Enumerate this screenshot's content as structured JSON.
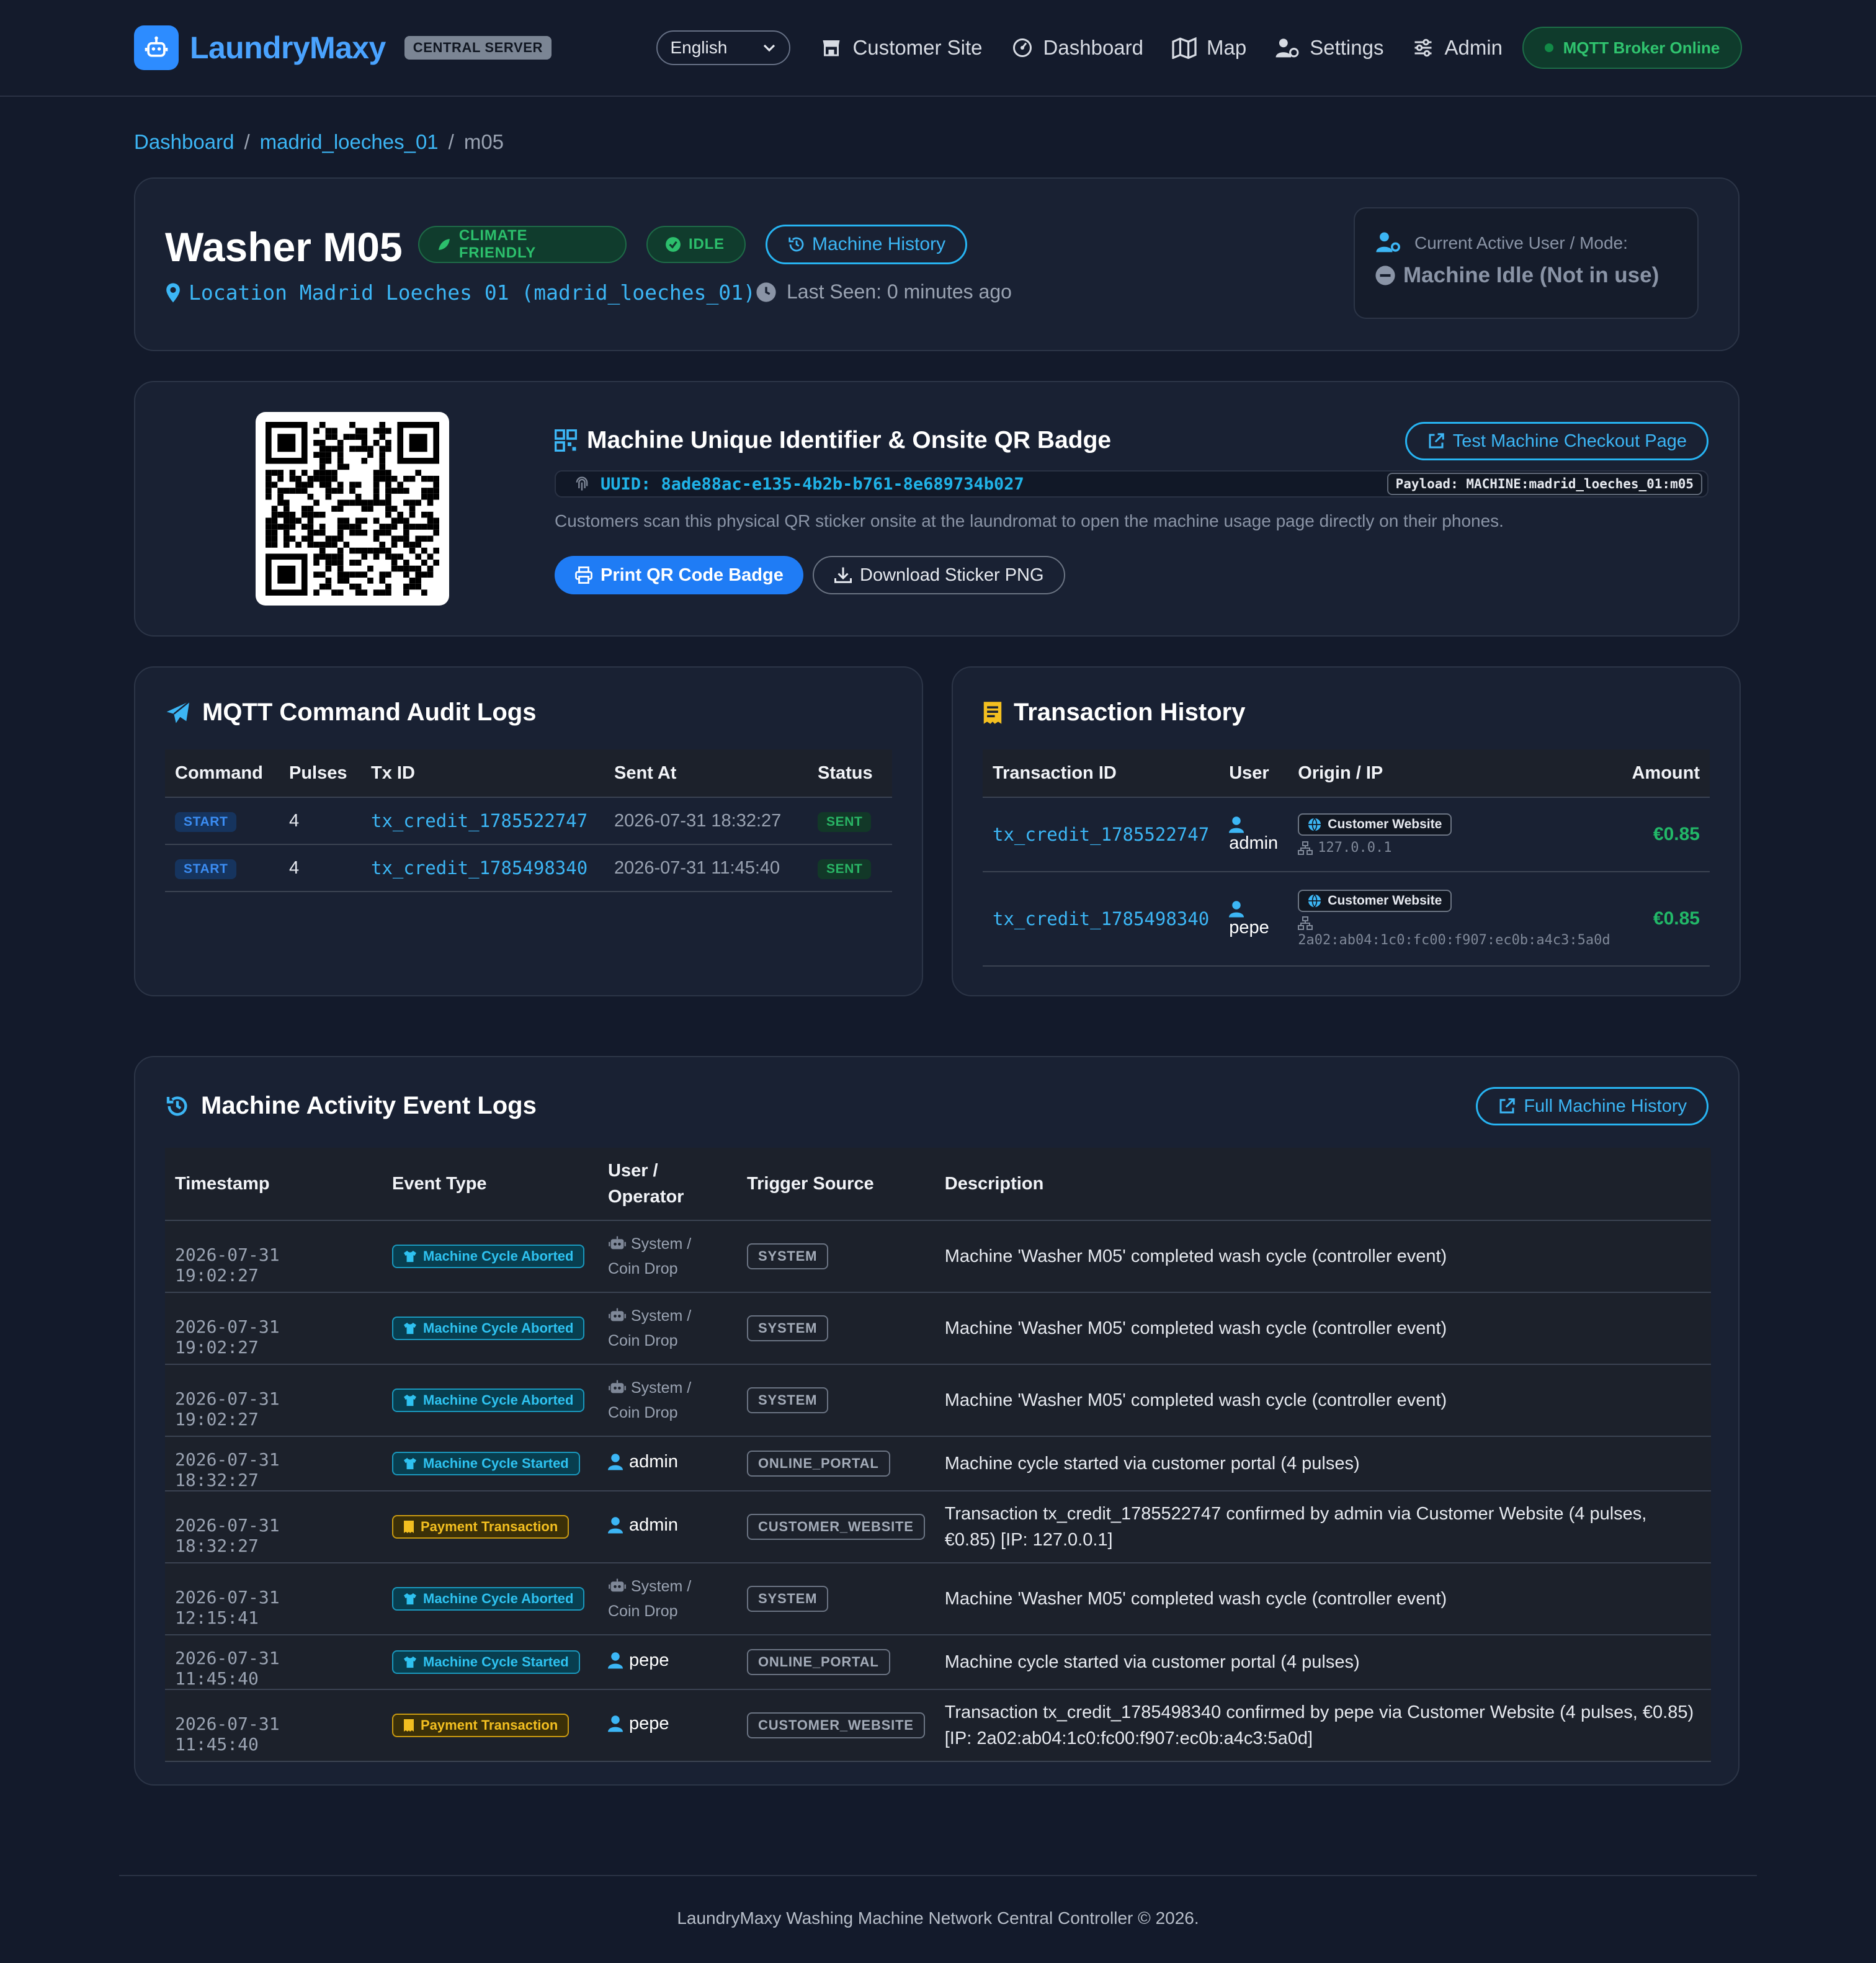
{
  "brand": {
    "name": "LaundryMaxy",
    "badge": "CENTRAL SERVER"
  },
  "nav": {
    "language": "English",
    "links": [
      {
        "icon": "store-icon",
        "label": "Customer Site"
      },
      {
        "icon": "dashboard-icon",
        "label": "Dashboard"
      },
      {
        "icon": "map-icon",
        "label": "Map"
      },
      {
        "icon": "user-gear-icon",
        "label": "Settings"
      },
      {
        "icon": "sliders-icon",
        "label": "Admin"
      }
    ],
    "mqtt_status": "MQTT Broker Online"
  },
  "breadcrumb": {
    "root": "Dashboard",
    "location": "madrid_loeches_01",
    "current": "m05"
  },
  "machine": {
    "title": "Washer M05",
    "climate_badge": "CLIMATE FRIENDLY",
    "status_badge": "IDLE",
    "history_button": "Machine History",
    "location": "Location Madrid Loeches 01 (madrid_loeches_01)",
    "last_seen": "Last Seen: 0 minutes ago",
    "active_user_label": "Current Active User / Mode:",
    "active_user_value": "Machine Idle (Not in use)"
  },
  "qr": {
    "title": "Machine Unique Identifier & Onsite QR Badge",
    "test_button": "Test Machine Checkout Page",
    "uuid": "UUID: 8ade88ac-e135-4b2b-b761-8e689734b027",
    "payload": "Payload: MACHINE:madrid_loeches_01:m05",
    "description": "Customers scan this physical QR sticker onsite at the laundromat to open the machine usage page directly on their phones.",
    "print_button": "Print QR Code Badge",
    "download_button": "Download Sticker PNG"
  },
  "mqtt_logs": {
    "title": "MQTT Command Audit Logs",
    "columns": [
      "Command",
      "Pulses",
      "Tx ID",
      "Sent At",
      "Status"
    ],
    "rows": [
      {
        "command": "START",
        "pulses": "4",
        "tx_id": "tx_credit_1785522747",
        "sent_at": "2026-07-31 18:32:27",
        "status": "SENT"
      },
      {
        "command": "START",
        "pulses": "4",
        "tx_id": "tx_credit_1785498340",
        "sent_at": "2026-07-31 11:45:40",
        "status": "SENT"
      }
    ]
  },
  "transactions": {
    "title": "Transaction History",
    "columns": [
      "Transaction ID",
      "User",
      "Origin / IP",
      "Amount"
    ],
    "rows": [
      {
        "tx_id": "tx_credit_1785522747",
        "user": "admin",
        "origin": "Customer Website",
        "ip": "127.0.0.1",
        "amount": "€0.85"
      },
      {
        "tx_id": "tx_credit_1785498340",
        "user": "pepe",
        "origin": "Customer Website",
        "ip": "2a02:ab04:1c0:fc00:f907:ec0b:a4c3:5a0d",
        "amount": "€0.85"
      }
    ]
  },
  "activity": {
    "title": "Machine Activity Event Logs",
    "full_button": "Full Machine History",
    "columns": [
      "Timestamp",
      "Event Type",
      "User / Operator",
      "Trigger Source",
      "Description"
    ],
    "rows": [
      {
        "ts": "2026-07-31 19:02:27",
        "event": "Machine Cycle Aborted",
        "kind": "cyan",
        "op_type": "system",
        "op": "System / Coin Drop",
        "trigger": "SYSTEM",
        "desc": "Machine 'Washer M05' completed wash cycle (controller event)"
      },
      {
        "ts": "2026-07-31 19:02:27",
        "event": "Machine Cycle Aborted",
        "kind": "cyan",
        "op_type": "system",
        "op": "System / Coin Drop",
        "trigger": "SYSTEM",
        "desc": "Machine 'Washer M05' completed wash cycle (controller event)"
      },
      {
        "ts": "2026-07-31 19:02:27",
        "event": "Machine Cycle Aborted",
        "kind": "cyan",
        "op_type": "system",
        "op": "System / Coin Drop",
        "trigger": "SYSTEM",
        "desc": "Machine 'Washer M05' completed wash cycle (controller event)"
      },
      {
        "ts": "2026-07-31 18:32:27",
        "event": "Machine Cycle Started",
        "kind": "cyan",
        "op_type": "user",
        "op": "admin",
        "trigger": "ONLINE_PORTAL",
        "desc": "Machine cycle started via customer portal (4 pulses)"
      },
      {
        "ts": "2026-07-31 18:32:27",
        "event": "Payment Transaction",
        "kind": "yellow",
        "op_type": "user",
        "op": "admin",
        "trigger": "CUSTOMER_WEBSITE",
        "desc": "Transaction tx_credit_1785522747 confirmed by admin via Customer Website (4 pulses, €0.85) [IP: 127.0.0.1]"
      },
      {
        "ts": "2026-07-31 12:15:41",
        "event": "Machine Cycle Aborted",
        "kind": "cyan",
        "op_type": "system",
        "op": "System / Coin Drop",
        "trigger": "SYSTEM",
        "desc": "Machine 'Washer M05' completed wash cycle (controller event)"
      },
      {
        "ts": "2026-07-31 11:45:40",
        "event": "Machine Cycle Started",
        "kind": "cyan",
        "op_type": "user",
        "op": "pepe",
        "trigger": "ONLINE_PORTAL",
        "desc": "Machine cycle started via customer portal (4 pulses)"
      },
      {
        "ts": "2026-07-31 11:45:40",
        "event": "Payment Transaction",
        "kind": "yellow",
        "op_type": "user",
        "op": "pepe",
        "trigger": "CUSTOMER_WEBSITE",
        "desc": "Transaction tx_credit_1785498340 confirmed by pepe via Customer Website (4 pulses, €0.85) [IP: 2a02:ab04:1c0:fc00:f907:ec0b:a4c3:5a0d]"
      }
    ]
  },
  "footer": "LaundryMaxy Washing Machine Network Central Controller © 2026."
}
